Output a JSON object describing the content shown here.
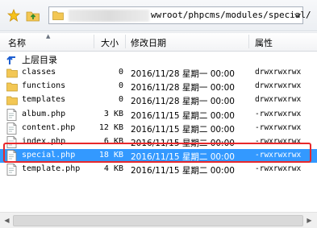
{
  "toolbar": {
    "path_text": "wwroot/phpcms/modules/special/"
  },
  "columns": {
    "name": "名称",
    "size": "大小",
    "date": "修改日期",
    "perm": "属性"
  },
  "up_entry": {
    "label": "上层目录"
  },
  "files": [
    {
      "name": "classes",
      "size": "0",
      "date": "2016/11/28 星期一 00:00",
      "perm": "drwxrwxrwx",
      "type": "folder"
    },
    {
      "name": "functions",
      "size": "0",
      "date": "2016/11/28 星期一 00:00",
      "perm": "drwxrwxrwx",
      "type": "folder"
    },
    {
      "name": "templates",
      "size": "0",
      "date": "2016/11/28 星期一 00:00",
      "perm": "drwxrwxrwx",
      "type": "folder"
    },
    {
      "name": "album.php",
      "size": "3 KB",
      "date": "2016/11/15 星期二 00:00",
      "perm": "-rwxrwxrwx",
      "type": "php"
    },
    {
      "name": "content.php",
      "size": "12 KB",
      "date": "2016/11/15 星期二 00:00",
      "perm": "-rwxrwxrwx",
      "type": "php"
    },
    {
      "name": "index.php",
      "size": "6 KB",
      "date": "2016/11/15 星期二 00:00",
      "perm": "-rwxrwxrwx",
      "type": "php"
    },
    {
      "name": "special.php",
      "size": "18 KB",
      "date": "2016/11/15 星期二 00:00",
      "perm": "-rwxrwxrwx",
      "type": "php",
      "selected": true
    },
    {
      "name": "template.php",
      "size": "4 KB",
      "date": "2016/11/15 星期二 00:00",
      "perm": "-rwxrwxrwx",
      "type": "php"
    }
  ],
  "colors": {
    "selection": "#3399ff",
    "highlight_border": "#e8282b"
  }
}
